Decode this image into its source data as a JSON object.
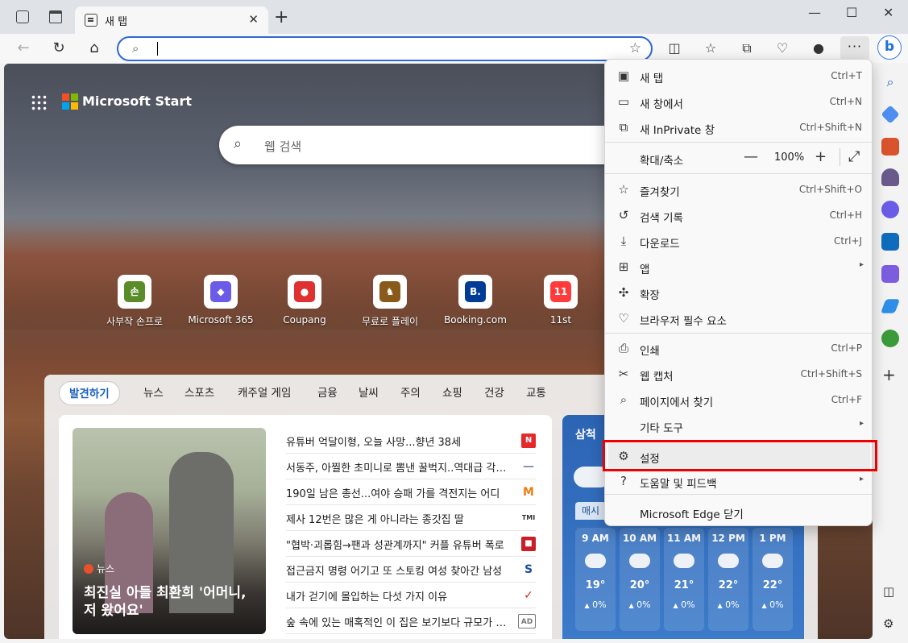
{
  "browser": {
    "tab_title": "새 탭",
    "tab_close": "✕",
    "new_tab": "+",
    "window_controls": [
      "—",
      "☐",
      "✕"
    ],
    "more_label": "···",
    "bing_label": "b"
  },
  "start": {
    "brand": "Microsoft Start",
    "search_placeholder": "웹 검색",
    "logo_colors": [
      "#f25022",
      "#7fba00",
      "#00a4ef",
      "#ffb900"
    ],
    "sites": [
      {
        "label": "사부작 손프로",
        "glyph": "손",
        "color": "#5a8c2a"
      },
      {
        "label": "Microsoft 365",
        "glyph": "◆",
        "color": "#6b5ce7"
      },
      {
        "label": "Coupang",
        "glyph": "●",
        "color": "#e03131"
      },
      {
        "label": "무료로 플레이",
        "glyph": "♞",
        "color": "#8a5a1a"
      },
      {
        "label": "Booking.com",
        "glyph": "B.",
        "color": "#003b95"
      },
      {
        "label": "11st",
        "glyph": "11",
        "color": "#ff3b3b"
      }
    ]
  },
  "feed": {
    "tabs": [
      "발견하기",
      "뉴스",
      "스포츠",
      "캐주얼 게임",
      "금융",
      "날씨",
      "주의",
      "쇼핑",
      "건강",
      "교통"
    ],
    "hero": {
      "source": "뉴스",
      "headline": "최진실 아들 최환희 '어머니, 저 왔어요'"
    },
    "headlines": [
      {
        "title": "유튜버 억달이형, 오늘 사망...향년 38세",
        "logo": "N",
        "logo_color": "#e5282a"
      },
      {
        "title": "서동주, 아찔한 초미니로 뽐낸 꿀벅지..역대급 각선미",
        "logo": "—",
        "logo_color": "#7a8ca0"
      },
      {
        "title": "190일 남은 총선...여야 승패 가를 격전지는 어디",
        "logo": "M",
        "logo_color": "#f07b10"
      },
      {
        "title": "제사 12번은 많은 게 아니라는 종갓집 딸",
        "logo": "TMI",
        "logo_color": "#333333"
      },
      {
        "title": "\"협박·괴롭힘→팬과 성관계까지\" 커플 유튜버 폭로",
        "logo": "■",
        "logo_color": "#c8202a"
      },
      {
        "title": "접근금지 명령 어기고 또 스토킹 여성 찾아간 남성",
        "logo": "S",
        "logo_color": "#1a4fa0"
      },
      {
        "title": "내가 걷기에 몰입하는 다섯 가지 이유",
        "logo": "✓",
        "logo_color": "#d02a2a"
      },
      {
        "title": "숲 속에 있는 매혹적인 이 집은 보기보다 규모가 크다",
        "logo": "AD",
        "logo_color": "#777777"
      }
    ]
  },
  "weather": {
    "city": "삼척",
    "tab": "매시",
    "hours": [
      {
        "time": "9 AM",
        "temp": "19°",
        "precip": "0%",
        "icon": "cloudy"
      },
      {
        "time": "10 AM",
        "temp": "20°",
        "precip": "0%",
        "icon": "cloudy"
      },
      {
        "time": "11 AM",
        "temp": "21°",
        "precip": "0%",
        "icon": "partly-sunny"
      },
      {
        "time": "12 PM",
        "temp": "22°",
        "precip": "0%",
        "icon": "partly-sunny"
      },
      {
        "time": "1 PM",
        "temp": "22°",
        "precip": "0%",
        "icon": "partly-sunny"
      }
    ],
    "precip_icon": "💧"
  },
  "menu": {
    "items": [
      {
        "id": "new-tab",
        "icon": "▣",
        "label": "새 탭",
        "shortcut": "Ctrl+T"
      },
      {
        "id": "new-window",
        "icon": "▭",
        "label": "새 창에서",
        "shortcut": "Ctrl+N"
      },
      {
        "id": "new-inprivate",
        "icon": "⧉",
        "label": "새 InPrivate 창",
        "shortcut": "Ctrl+Shift+N"
      },
      {
        "id": "favorites",
        "icon": "☆",
        "label": "즐겨찾기",
        "shortcut": "Ctrl+Shift+O"
      },
      {
        "id": "history",
        "icon": "↺",
        "label": "검색 기록",
        "shortcut": "Ctrl+H"
      },
      {
        "id": "downloads",
        "icon": "⤓",
        "label": "다운로드",
        "shortcut": "Ctrl+J"
      },
      {
        "id": "apps",
        "icon": "⊞",
        "label": "앱",
        "shortcut": "▸"
      },
      {
        "id": "extensions",
        "icon": "✣",
        "label": "확장",
        "shortcut": ""
      },
      {
        "id": "browser-essentials",
        "icon": "♡",
        "label": "브라우저 필수 요소",
        "shortcut": ""
      },
      {
        "id": "print",
        "icon": "⎙",
        "label": "인쇄",
        "shortcut": "Ctrl+P"
      },
      {
        "id": "web-capture",
        "icon": "✂",
        "label": "웹 캡처",
        "shortcut": "Ctrl+Shift+S"
      },
      {
        "id": "find",
        "icon": "⌕",
        "label": "페이지에서 찾기",
        "shortcut": "Ctrl+F"
      },
      {
        "id": "more-tools",
        "icon": "",
        "label": "기타 도구",
        "shortcut": "▸"
      },
      {
        "id": "settings",
        "icon": "⚙",
        "label": "설정",
        "shortcut": ""
      },
      {
        "id": "help",
        "icon": "?",
        "label": "도움말 및 피드백",
        "shortcut": "▸"
      },
      {
        "id": "close-edge",
        "icon": "",
        "label": "Microsoft Edge 닫기",
        "shortcut": ""
      }
    ],
    "zoom": {
      "label": "확대/축소",
      "minus": "—",
      "value": "100%",
      "plus": "+",
      "fullscreen": "⤢"
    }
  }
}
